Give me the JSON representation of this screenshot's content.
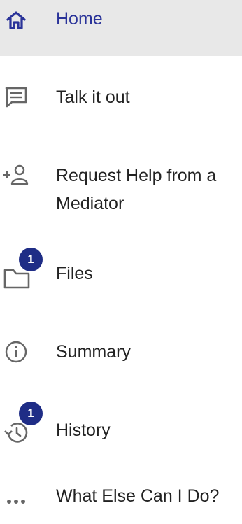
{
  "nav": {
    "items": [
      {
        "id": "home",
        "label": "Home",
        "icon": "home-icon",
        "active": true
      },
      {
        "id": "talk",
        "label": "Talk it out",
        "icon": "chat-icon"
      },
      {
        "id": "mediator",
        "label_line1": "Request Help from a",
        "label_line2": "Mediator",
        "icon": "add-user-icon"
      },
      {
        "id": "files",
        "label": "Files",
        "icon": "folder-icon",
        "badge": "1"
      },
      {
        "id": "summary",
        "label": "Summary",
        "icon": "info-icon"
      },
      {
        "id": "history",
        "label": "History",
        "icon": "history-icon",
        "badge": "1"
      },
      {
        "id": "more",
        "label": "What Else Can I Do?",
        "icon": "more-icon"
      }
    ]
  },
  "colors": {
    "active_bg": "#e8e8e8",
    "active_text": "#2a3399",
    "badge_bg": "#1f2d86",
    "icon_gray": "#666666"
  }
}
